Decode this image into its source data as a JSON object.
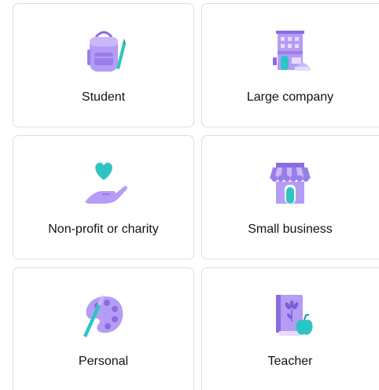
{
  "options": [
    {
      "label": "Student",
      "icon": "backpack-icon"
    },
    {
      "label": "Large company",
      "icon": "office-building-icon"
    },
    {
      "label": "Non-profit or charity",
      "icon": "heart-in-hand-icon"
    },
    {
      "label": "Small business",
      "icon": "storefront-icon"
    },
    {
      "label": "Personal",
      "icon": "paint-palette-icon"
    },
    {
      "label": "Teacher",
      "icon": "book-with-apple-icon"
    }
  ],
  "colors": {
    "lavender": "#a98bf0",
    "lavender_light": "#cbb8fb",
    "lavender_dark": "#7b5dd6",
    "teal": "#2ec4c4",
    "text": "#0e1318",
    "border": "#dcdde2"
  }
}
